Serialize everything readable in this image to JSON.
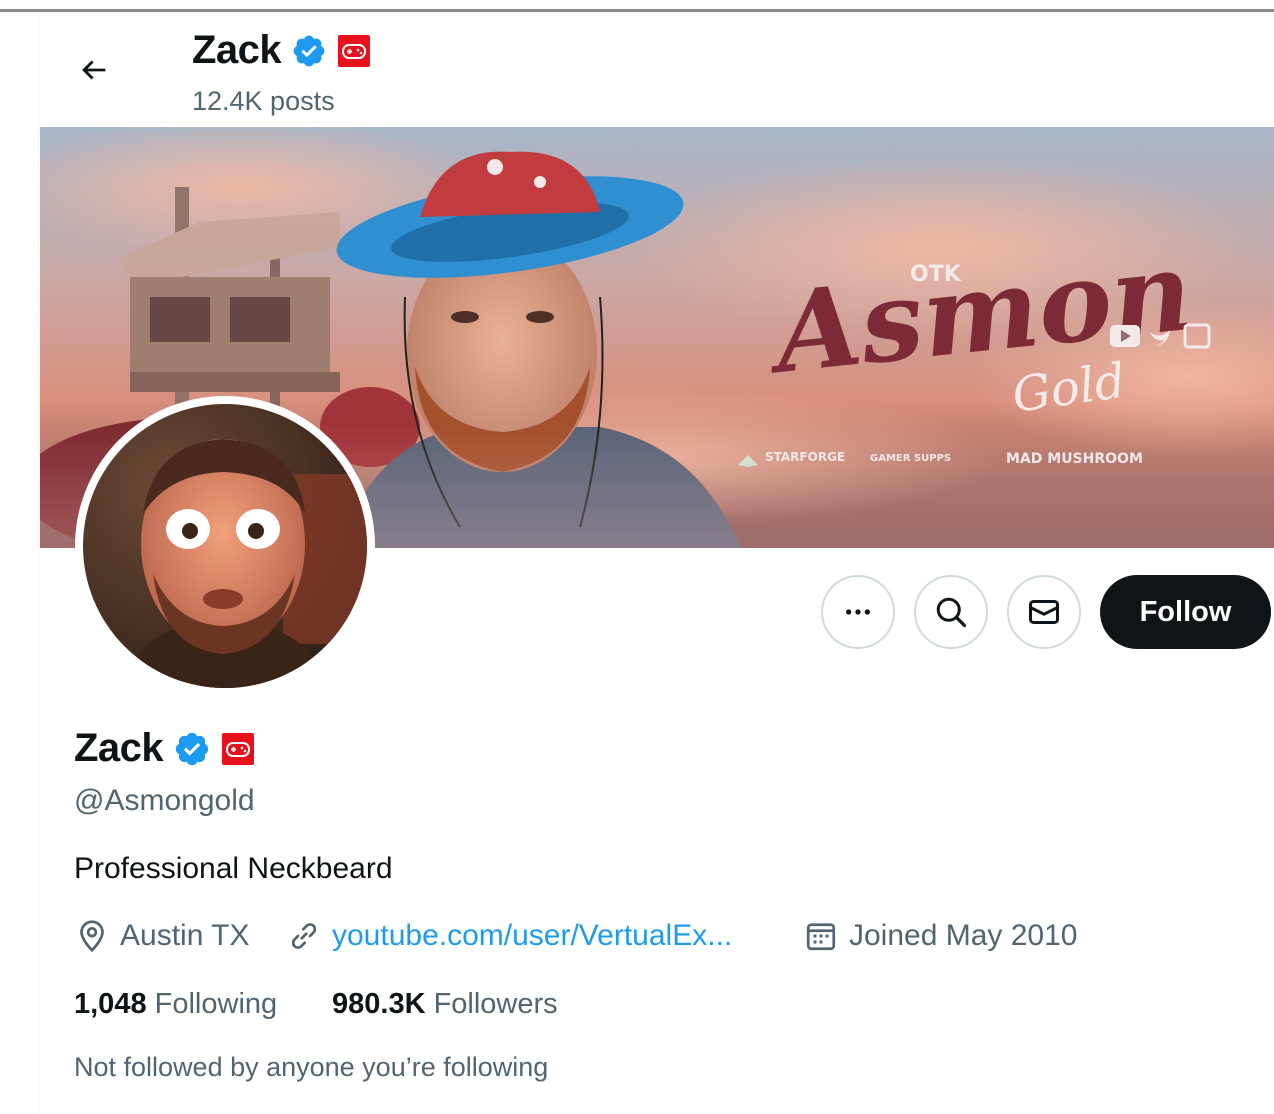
{
  "header": {
    "name": "Zack",
    "posts": "12.4K posts"
  },
  "banner": {
    "logo_text": "Asmon",
    "logo_sub": "Gold",
    "brand_tag": "OTK",
    "sponsors": [
      "STARFORGE",
      "GAMER SUPPS",
      "MAD MUSHROOM"
    ]
  },
  "actions": {
    "more_icon": "more-icon",
    "search_icon": "search-icon",
    "message_icon": "mail-icon",
    "follow_label": "Follow"
  },
  "profile": {
    "name": "Zack",
    "handle": "@Asmongold",
    "bio": "Professional Neckbeard",
    "location": "Austin TX",
    "website": "youtube.com/user/VertualEx...",
    "joined": "Joined May 2010",
    "following_count": "1,048",
    "following_label": "Following",
    "followers_count": "980.3K",
    "followers_label": "Followers",
    "mutuals_note": "Not followed by anyone you’re following"
  },
  "colors": {
    "verified": "#1d9bf0",
    "affiliate_badge": "#e8101a",
    "link": "#1d9bf0",
    "follow_button": "#0f1419"
  }
}
